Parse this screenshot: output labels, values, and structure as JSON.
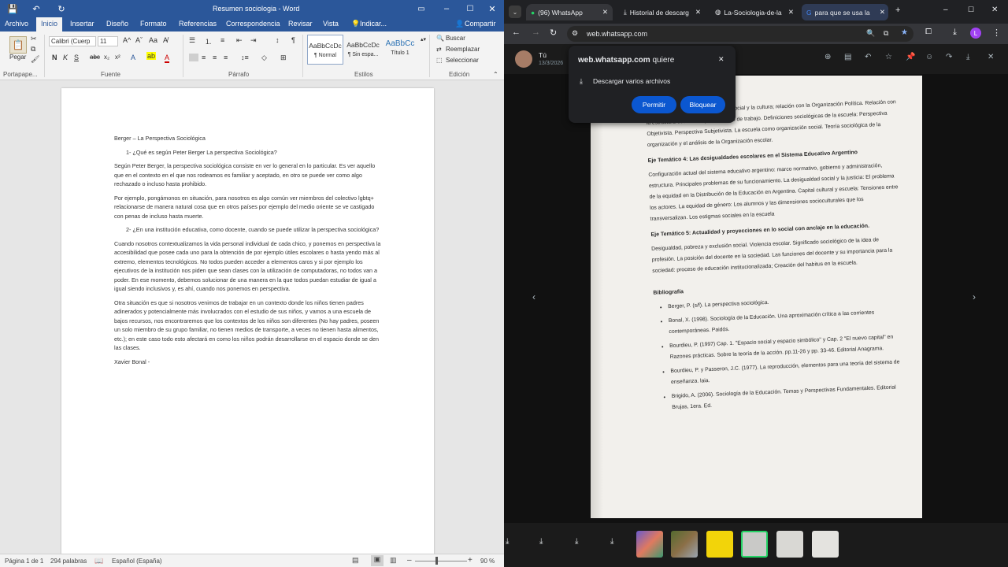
{
  "word": {
    "window_title": "Resumen sociologia - Word",
    "tabs": [
      "Archivo",
      "Inicio",
      "Insertar",
      "Diseño",
      "Formato",
      "Referencias",
      "Correspondencia",
      "Revisar",
      "Vista",
      "Indicar...",
      "Compartir"
    ],
    "ribbon": {
      "paste_label": "Pegar",
      "font_name": "Calibri (Cuerp",
      "font_size": "11",
      "styles": [
        {
          "preview": "AaBbCcDc",
          "name": "¶ Normal"
        },
        {
          "preview": "AaBbCcDc",
          "name": "¶ Sin espa..."
        },
        {
          "preview": "AaBbCc",
          "name": "Título 1"
        }
      ],
      "find": "Buscar",
      "replace": "Reemplazar",
      "select": "Seleccionar",
      "groups": [
        "Portapape...",
        "Fuente",
        "Párrafo",
        "Estilos",
        "Edición"
      ]
    },
    "document": {
      "title": "Berger – La Perspectiva Sociológica",
      "q1": "1-   ¿Qué es según Peter Berger La perspectiva Sociológica?",
      "p1": "Según Peter Berger, la perspectiva sociológica consiste en ver lo general en lo particular. Es ver aquello que en el contexto en el que nos rodeamos es familiar y aceptado, en otro se puede ver como algo rechazado o incluso hasta prohibido.",
      "p2": "Por ejemplo, pongámonos en situación, para nosotros es algo común ver miembros del colectivo lgbtq+ relacionarse de manera natural cosa que en otros países por ejemplo del medio oriente se ve castigado con penas de incluso hasta muerte.",
      "q2": "2-   ¿En una institución educativa, como docente, cuando se puede utilizar la perspectiva sociológica?",
      "p3": "Cuando nosotros contextualizamos la vida personal individual de cada chico, y ponemos en perspectiva la accesibilidad que posee cada uno para la obtención de por ejemplo útiles escolares o hasta yendo más al extremo, elementos tecnológicos. No todos pueden acceder a elementos caros y si por ejemplo los ejecutivos de la institución nos piden que sean clases con la utilización de computadoras, no todos van a poder. En ese momento, debemos solucionar de una manera en la que todos puedan estudiar de igual a igual siendo inclusivos y, es ahí, cuando nos ponemos en perspectiva.",
      "p4": "Otra situación es que si nosotros venimos de trabajar en un contexto donde los niños tienen padres adinerados y potencialmente más involucrados con el estudio de sus niños, y vamos a una escuela de bajos recursos, nos encontraremos que los contextos de los niños son diferentes (No hay padres, poseen un solo miembro de su grupo familiar, no tienen medios de transporte, a veces no tienen hasta alimentos, etc.); en este caso todo esto afectará en como los niños podrán desarrollarse en el espacio donde se den las clases.",
      "p5": "Xavier Bonal -"
    },
    "status": {
      "page": "Página 1 de 1",
      "words": "294 palabras",
      "language": "Español (España)",
      "zoom": "90 %"
    }
  },
  "chrome": {
    "tabs": [
      "(96) WhatsApp",
      "Historial de descarg",
      "La-Sociologia-de-la",
      "para que se usa la"
    ],
    "url": "web.whatsapp.com",
    "sender": "Tú",
    "date": "13/3/2026",
    "popup": {
      "site": "web.whatsapp.com",
      "verb": "quiere",
      "permission": "Descargar varios archivos",
      "allow": "Permitir",
      "block": "Bloquear"
    },
    "photo": {
      "l1": "sociedad, relación con la estructura social y la cultura; relación con la Organización Política. Relación con la estructura económica y el mercado de trabajo. Definiciones sociológicas de la escuela: Perspectiva Objetivista. Perspectiva Subjetivista. La escuela como organización social. Teoría sociológica de la organización y el análisis de la Organización escolar.",
      "h4": "Eje Temático 4: Las desigualdades escolares en el Sistema Educativo Argentino",
      "p4": "Configuración actual del sistema educativo argentino: marco normativo, gobierno y administración, estructura. Principales problemas de su funcionamiento. La desigualdad social y la justicia: El problema de la equidad en la Distribución de la Educación en Argentina. Capital cultural y escuela: Tensiones entre los actores. La equidad de género: Los alumnos y las dimensiones socioculturales que los transversalizan. Los estigmas sociales en la escuela",
      "h5": "Eje Temático 5: Actualidad y proyecciones en lo social con anclaje en la educación.",
      "p5": "Desigualdad, pobreza y exclusión social. Violencia escolar. Significado sociológico de la idea de profesión. La posición del docente en la sociedad. Las funciones del docente y su importancia para la sociedad: proceso de educación institucionalizada; Creación del habitus en la escuela.",
      "biblio_title": "Bibliografía",
      "biblio": [
        "Berger, P. (s/f). La perspectiva sociológica.",
        "Bonal, X. (1998). Sociología de la Educación. Una aproximación crítica a las corrientes contemporáneas. Paidós.",
        "Bourdieu, P. (1997) Cap. 1. \"Espacio social y espacio simbólico\" y Cap. 2 \"El nuevo capital\" en Razones prácticas. Sobre la teoría de la acción. pp.11-26 y pp. 33-46. Editorial Anagrama.",
        "Bourdieu, P. y Passeron, J.C. (1977). La reproducción, elementos para una teoría del sistema de enseñanza. laia.",
        "Brigido, A. (2006). Sociología de la Educación. Temas y Perspectivas Fundamentales. Editorial Brujas, 1era. Ed."
      ]
    }
  }
}
